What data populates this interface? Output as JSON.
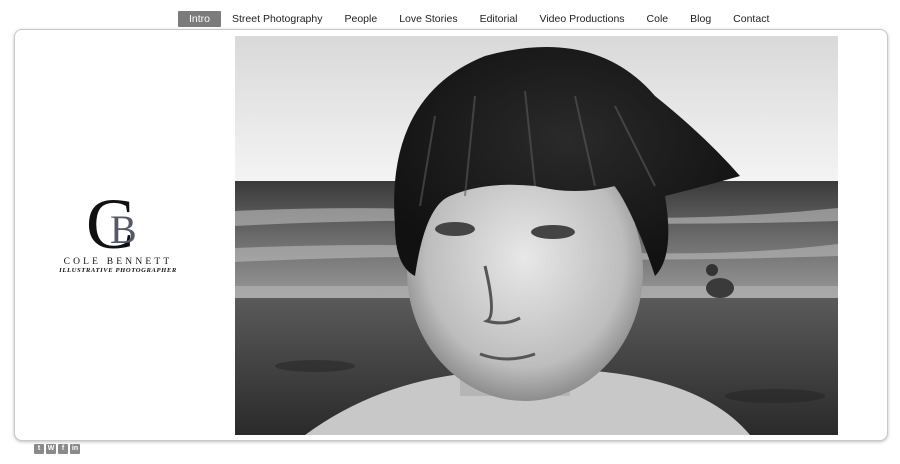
{
  "nav": {
    "items": [
      {
        "label": "Intro",
        "active": true
      },
      {
        "label": "Street Photography",
        "active": false
      },
      {
        "label": "People",
        "active": false
      },
      {
        "label": "Love Stories",
        "active": false
      },
      {
        "label": "Editorial",
        "active": false
      },
      {
        "label": "Video Productions",
        "active": false
      },
      {
        "label": "Cole",
        "active": false
      },
      {
        "label": "Blog",
        "active": false
      },
      {
        "label": "Contact",
        "active": false
      }
    ]
  },
  "logo": {
    "monogram_left": "C",
    "monogram_right": "B",
    "name": "COLE BENNETT",
    "tagline": "ILLUSTRATIVE PHOTOGRAPHER"
  },
  "hero": {
    "description": "black-and-white photo of a freckled boy on a beach"
  },
  "social": {
    "icons": [
      {
        "name": "twitter-icon",
        "glyph": "t"
      },
      {
        "name": "wordpress-icon",
        "glyph": "W"
      },
      {
        "name": "facebook-icon",
        "glyph": "f"
      },
      {
        "name": "linkedin-icon",
        "glyph": "in"
      }
    ]
  },
  "colors": {
    "nav_active_bg": "#7b7b7b",
    "nav_text": "#222222",
    "frame_border": "#c8c8c8",
    "monogram_c": "#111111",
    "monogram_b": "#55586a"
  }
}
